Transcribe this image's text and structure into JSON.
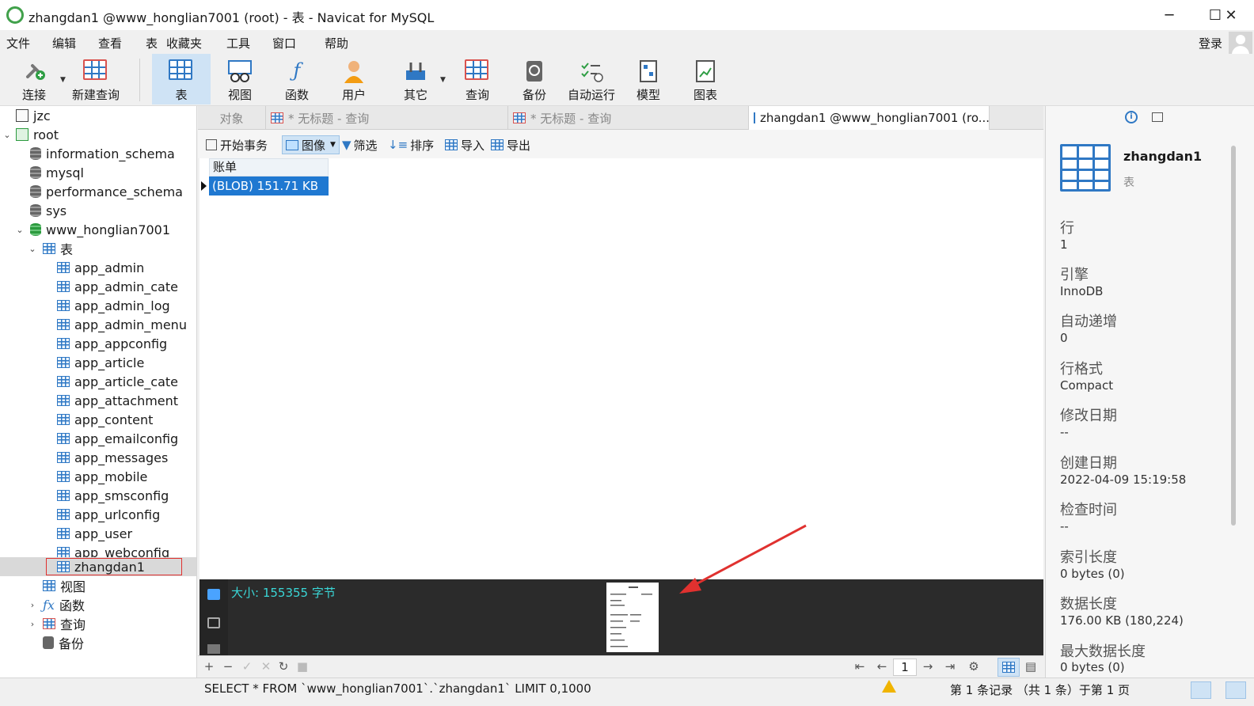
{
  "window": {
    "title": "zhangdan1 @www_honglian7001 (root) - 表 - Navicat for MySQL",
    "minimize": "─",
    "maximize": "☐",
    "close": "✕"
  },
  "menu": {
    "items": [
      "文件",
      "编辑",
      "查看",
      "表",
      "收藏夹",
      "工具",
      "窗口",
      "帮助"
    ],
    "login": "登录"
  },
  "toolbar": {
    "connect": "连接",
    "new_query": "新建查询",
    "table": "表",
    "view": "视图",
    "function": "函数",
    "user": "用户",
    "other": "其它",
    "query": "查询",
    "backup": "备份",
    "auto_run": "自动运行",
    "model": "模型",
    "chart": "图表"
  },
  "sidebar": {
    "items": [
      {
        "label": "jzc"
      },
      {
        "label": "root"
      },
      {
        "label": "information_schema"
      },
      {
        "label": "mysql"
      },
      {
        "label": "performance_schema"
      },
      {
        "label": "sys"
      },
      {
        "label": "www_honglian7001"
      },
      {
        "label": "表"
      },
      {
        "label": "app_admin"
      },
      {
        "label": "app_admin_cate"
      },
      {
        "label": "app_admin_log"
      },
      {
        "label": "app_admin_menu"
      },
      {
        "label": "app_appconfig"
      },
      {
        "label": "app_article"
      },
      {
        "label": "app_article_cate"
      },
      {
        "label": "app_attachment"
      },
      {
        "label": "app_content"
      },
      {
        "label": "app_emailconfig"
      },
      {
        "label": "app_messages"
      },
      {
        "label": "app_mobile"
      },
      {
        "label": "app_smsconfig"
      },
      {
        "label": "app_urlconfig"
      },
      {
        "label": "app_user"
      },
      {
        "label": "app_webconfig"
      },
      {
        "label": "zhangdan1"
      },
      {
        "label": "视图"
      },
      {
        "label": "函数"
      },
      {
        "label": "查询"
      },
      {
        "label": "备份"
      }
    ]
  },
  "tabs": {
    "objects": "对象",
    "query1": "* 无标题 - 查询",
    "query2": "* 无标题 - 查询",
    "active": "zhangdan1 @www_honglian7001 (ro..."
  },
  "content_toolbar": {
    "begin_tx": "开始事务",
    "image": "图像",
    "filter": "筛选",
    "sort": "排序",
    "import": "导入",
    "export": "导出"
  },
  "grid": {
    "column": "账单",
    "cell": "(BLOB) 151.71 KB"
  },
  "viewer": {
    "size": "大小: 155355 字节"
  },
  "nav": {
    "page": "1"
  },
  "status": {
    "sql": "SELECT * FROM `www_honglian7001`.`zhangdan1` LIMIT 0,1000",
    "records": "第 1 条记录 （共 1 条）于第 1 页"
  },
  "info": {
    "name": "zhangdan1",
    "type": "表",
    "props": [
      {
        "label": "行",
        "value": "1"
      },
      {
        "label": "引擎",
        "value": "InnoDB"
      },
      {
        "label": "自动递增",
        "value": "0"
      },
      {
        "label": "行格式",
        "value": "Compact"
      },
      {
        "label": "修改日期",
        "value": "--"
      },
      {
        "label": "创建日期",
        "value": "2022-04-09 15:19:58"
      },
      {
        "label": "检查时间",
        "value": "--"
      },
      {
        "label": "索引长度",
        "value": "0 bytes (0)"
      },
      {
        "label": "数据长度",
        "value": "176.00 KB (180,224)"
      },
      {
        "label": "最大数据长度",
        "value": "0 bytes (0)"
      }
    ]
  },
  "colors": {
    "accent": "#1f78d1",
    "selection_border": "#e0312f",
    "size_text": "#3ad6d6"
  }
}
